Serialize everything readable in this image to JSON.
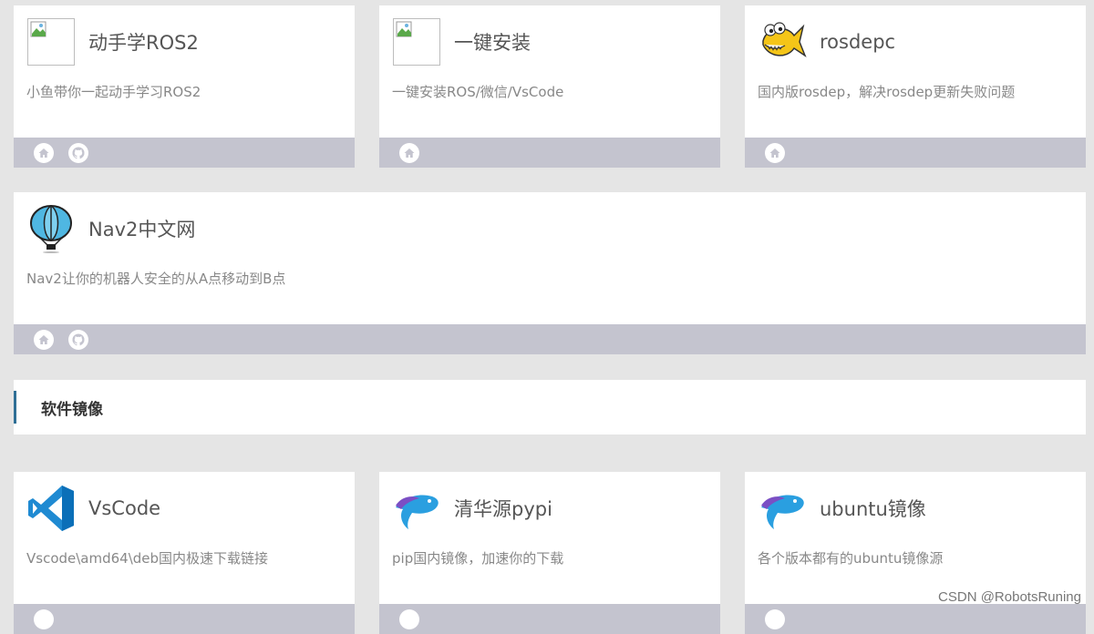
{
  "cards_row1": [
    {
      "title": "动手学ROS2",
      "desc": "小鱼带你一起动手学习ROS2",
      "icon": "broken-image-icon",
      "buttons": [
        "home",
        "github"
      ]
    },
    {
      "title": "一键安装",
      "desc": "一键安装ROS/微信/VsCode",
      "icon": "broken-image-icon",
      "buttons": [
        "home"
      ]
    },
    {
      "title": "rosdepc",
      "desc": "国内版rosdep，解决rosdep更新失败问题",
      "icon": "fish-mascot-icon",
      "buttons": [
        "home"
      ]
    }
  ],
  "card_wide": {
    "title": "Nav2中文网",
    "desc": "Nav2让你的机器人安全的从A点移动到B点",
    "icon": "hot-air-balloon-icon",
    "buttons": [
      "home",
      "github"
    ]
  },
  "section": {
    "title": "软件镜像"
  },
  "cards_row2": [
    {
      "title": "VsCode",
      "desc": "Vscode\\amd64\\deb国内极速下载链接",
      "icon": "vscode-icon"
    },
    {
      "title": "清华源pypi",
      "desc": "pip国内镜像，加速你的下载",
      "icon": "tuna-fish-icon"
    },
    {
      "title": "ubuntu镜像",
      "desc": "各个版本都有的ubuntu镜像源",
      "icon": "tuna-fish-icon"
    }
  ],
  "watermark": "CSDN @RobotsRuning",
  "colors": {
    "page_bg": "#e5e5e5",
    "footer_bar": "#c4c4cf",
    "section_accent": "#2f6f96"
  }
}
